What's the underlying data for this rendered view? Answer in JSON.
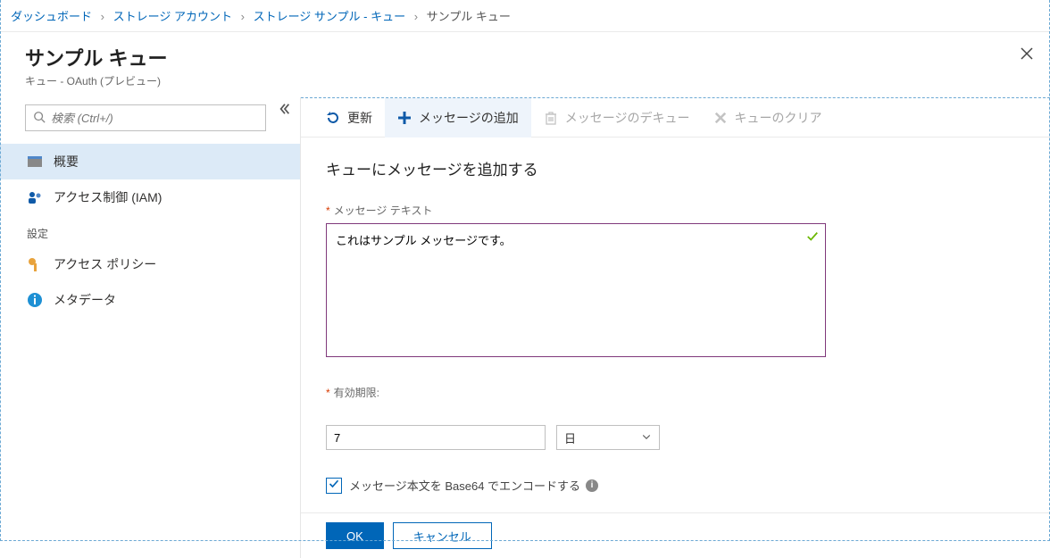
{
  "breadcrumb": {
    "items": [
      {
        "label": "ダッシュボード",
        "link": true
      },
      {
        "label": "ストレージ アカウント",
        "link": true
      },
      {
        "label": "ストレージ サンプル - キュー",
        "link": true
      },
      {
        "label": "サンプル キュー",
        "link": false
      }
    ]
  },
  "header": {
    "title": "サンプル キュー",
    "subtitle": "キュー - OAuth (プレビュー)"
  },
  "sidebar": {
    "search_placeholder": "検索 (Ctrl+/)",
    "items": {
      "overview": "概要",
      "iam": "アクセス制御 (IAM)"
    },
    "section_settings": "設定",
    "settings_items": {
      "policy": "アクセス ポリシー",
      "metadata": "メタデータ"
    }
  },
  "toolbar": {
    "refresh": "更新",
    "add": "メッセージの追加",
    "dequeue": "メッセージのデキュー",
    "clear": "キューのクリア"
  },
  "panel": {
    "title": "キューにメッセージを追加する",
    "msg_label": "メッセージ テキスト",
    "msg_value": "これはサンプル メッセージです。",
    "expiry_label": "有効期限:",
    "expiry_value": "7",
    "expiry_unit": "日",
    "base64_label": "メッセージ本文を Base64 でエンコードする",
    "base64_checked": true
  },
  "footer": {
    "ok": "OK",
    "cancel": "キャンセル"
  }
}
